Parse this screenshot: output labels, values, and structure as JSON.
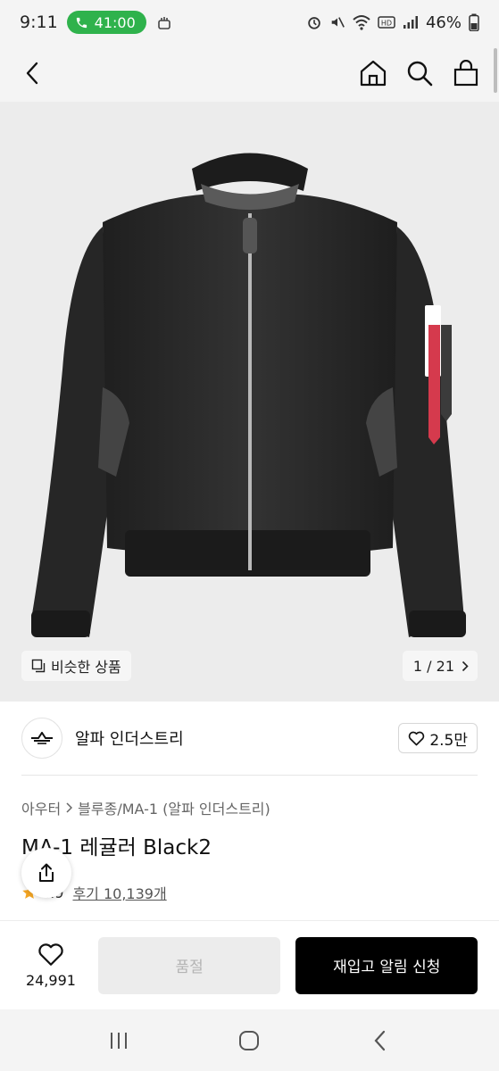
{
  "status_bar": {
    "time": "9:11",
    "call_duration": "41:00",
    "battery": "46%"
  },
  "icons": {
    "back": "back-arrow-icon",
    "home": "home-icon",
    "search": "search-icon",
    "cart": "shopping-bag-icon",
    "similar": "copy-icon",
    "page_next": "chevron-right-icon",
    "heart": "heart-icon",
    "share": "share-icon",
    "star": "star-icon"
  },
  "colors": {
    "call_pill": "#2fb24c",
    "restock_button": "#000000",
    "soldout_button": "#ececec",
    "jacket": "#2b2b2b",
    "tag_red": "#d53a4d"
  },
  "gallery": {
    "similar_label": "비슷한 상품",
    "page_indicator": "1 / 21"
  },
  "brand": {
    "name": "알파 인더스트리",
    "likes": "2.5만"
  },
  "product": {
    "breadcrumb": [
      "아우터",
      "블루종/MA-1 (알파 인더스트리)"
    ],
    "title": "MA-1 레귤러 Black2",
    "rating": "4.9",
    "reviews": "후기 10,139개"
  },
  "actions": {
    "wish_count": "24,991",
    "soldout_label": "품절",
    "restock_label": "재입고 알림 신청"
  }
}
